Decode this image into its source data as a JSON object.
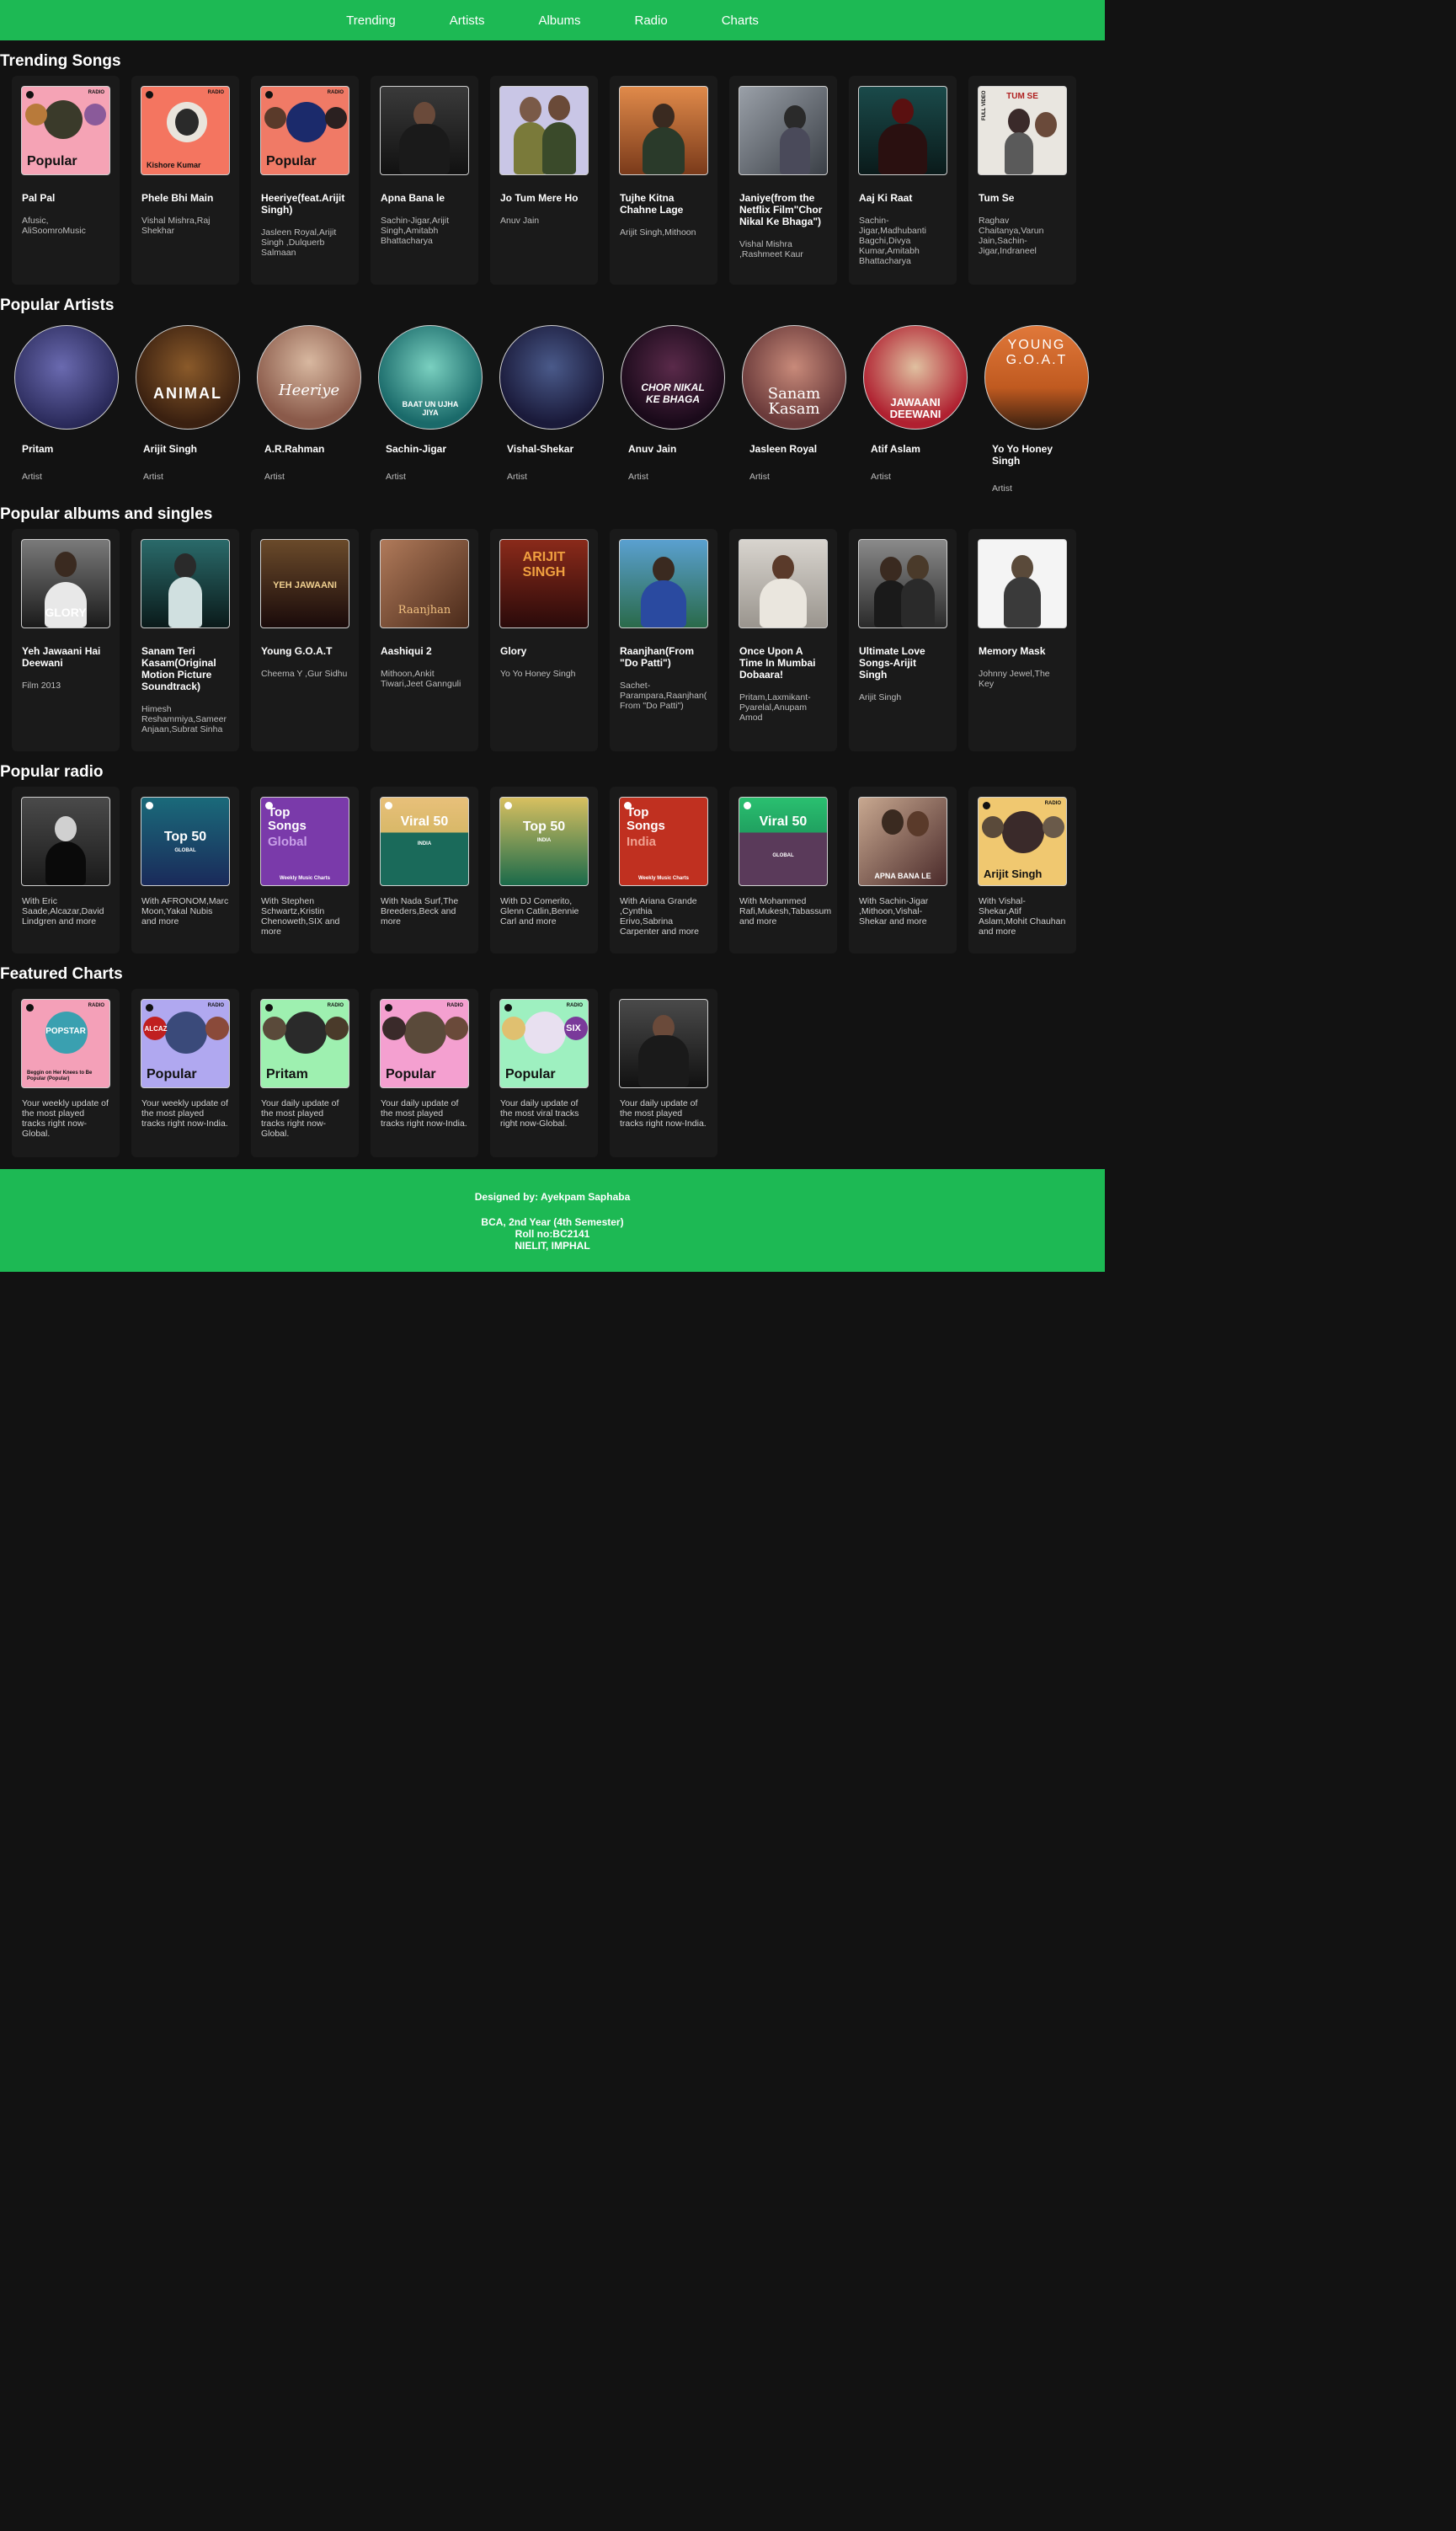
{
  "nav": {
    "items": [
      "Trending",
      "Artists",
      "Albums",
      "Radio",
      "Charts"
    ]
  },
  "sections": {
    "trending": "Trending Songs",
    "artists": "Popular Artists",
    "albums": "Popular albums and singles",
    "radio": "Popular radio",
    "charts": "Featured Charts"
  },
  "trending_songs": [
    {
      "title": "Pal Pal",
      "sub": "Afusic, AliSoomroMusic"
    },
    {
      "title": "Phele Bhi Main",
      "sub": "Vishal Mishra,Raj Shekhar"
    },
    {
      "title": "Heeriye(feat.Arijit Singh)",
      "sub": "Jasleen Royal,Arijit Singh ,Dulquerb Salmaan"
    },
    {
      "title": "Apna Bana le",
      "sub": "Sachin-Jigar,Arijit Singh,Amitabh Bhattacharya"
    },
    {
      "title": "Jo Tum Mere Ho",
      "sub": "Anuv Jain"
    },
    {
      "title": "Tujhe Kitna Chahne Lage",
      "sub": "Arijit Singh,Mithoon"
    },
    {
      "title": "Janiye(from the Netflix Film\"Chor Nikal Ke Bhaga\")",
      "sub": "Vishal Mishra ,Rashmeet Kaur"
    },
    {
      "title": "Aaj Ki Raat",
      "sub": "Sachin-Jigar,Madhubanti Bagchi,Divya Kumar,Amitabh Bhattacharya"
    },
    {
      "title": "Tum Se",
      "sub": "Raghav Chaitanya,Varun Jain,Sachin-Jigar,Indraneel"
    }
  ],
  "trending_covers": [
    {
      "label": "Popular",
      "radio": "RADIO"
    },
    {
      "label": "Kishore Kumar",
      "radio": "RADIO"
    },
    {
      "label": "Popular",
      "radio": "RADIO"
    },
    {},
    {},
    {},
    {},
    {},
    {
      "label": "TUM SE",
      "radio": "FULL VIDEO"
    }
  ],
  "artists": [
    {
      "name": "Pritam",
      "role": "Artist",
      "art": ""
    },
    {
      "name": "Arijit Singh",
      "role": "Artist",
      "art": "ANIMAL"
    },
    {
      "name": "A.R.Rahman",
      "role": "Artist",
      "art": "Heeriye"
    },
    {
      "name": "Sachin-Jigar",
      "role": "Artist",
      "art": "BAAT UN UJHA JIYA"
    },
    {
      "name": "Vishal-Shekar",
      "role": "Artist",
      "art": ""
    },
    {
      "name": "Anuv Jain",
      "role": "Artist",
      "art": "CHOR NIKAL KE BHAGA"
    },
    {
      "name": "Jasleen Royal",
      "role": "Artist",
      "art": "Sanam Kasam"
    },
    {
      "name": "Atif Aslam",
      "role": "Artist",
      "art": "JAWAANI DEEWANI"
    },
    {
      "name": "Yo Yo Honey Singh",
      "role": "Artist",
      "art": "YOUNG G.O.A.T"
    }
  ],
  "albums": [
    {
      "title": "Yeh Jawaani Hai Deewani",
      "sub": "Film 2013",
      "art": "GLORY"
    },
    {
      "title": "Sanam Teri Kasam(Original Motion Picture Soundtrack)",
      "sub": "Himesh Reshammiya,Sameer Anjaan,Subrat Sinha",
      "art": ""
    },
    {
      "title": "Young G.O.A.T",
      "sub": "Cheema Y ,Gur Sidhu",
      "art": "YEH JAWAANI"
    },
    {
      "title": "Aashiqui 2",
      "sub": "Mithoon,Ankit Tiwari,Jeet Gannguli",
      "art": "Raanjhan"
    },
    {
      "title": "Glory",
      "sub": "Yo Yo Honey Singh",
      "art": "ARIJIT SINGH"
    },
    {
      "title": "Raanjhan(From \"Do Patti\")",
      "sub": "Sachet-Parampara,Raanjhan( From \"Do Patti\")",
      "art": ""
    },
    {
      "title": "Once Upon A Time In Mumbai Dobaara!",
      "sub": "Pritam,Laxmikant-Pyarelal,Anupam Amod",
      "art": ""
    },
    {
      "title": "Ultimate Love Songs-Arijit Singh",
      "sub": "Arijit Singh",
      "art": ""
    },
    {
      "title": "Memory Mask",
      "sub": "Johnny Jewel,The Key",
      "art": ""
    }
  ],
  "radio": [
    {
      "desc": "With Eric Saade,Alcazar,David Lindgren and more",
      "big": "",
      "small": ""
    },
    {
      "desc": "With AFRONOM,Marc Moon,Yakal Nubis and more",
      "big": "Top 50",
      "small": "GLOBAL"
    },
    {
      "desc": "With Stephen Schwartz,Kristin Chenoweth,SIX and more",
      "big": "Top Songs",
      "small": "Global",
      "foot": "Weekly Music Charts"
    },
    {
      "desc": "With Nada Surf,The Breeders,Beck and more",
      "big": "Viral 50",
      "small": "INDIA"
    },
    {
      "desc": "With DJ Comerito, Glenn Catlin,Bennie Carl and more",
      "big": "Top 50",
      "small": "INDIA"
    },
    {
      "desc": "With Ariana Grande ,Cynthia Erivo,Sabrina Carpenter and more",
      "big": "Top Songs",
      "small": "India",
      "foot": "Weekly Music Charts"
    },
    {
      "desc": "With Mohammed Rafi,Mukesh,Tabassum and more",
      "big": "Viral 50",
      "small": "GLOBAL"
    },
    {
      "desc": "With Sachin-Jigar ,Mithoon,Vishal-Shekar and more",
      "big": "APNA BANA LE",
      "small": ""
    },
    {
      "desc": "With Vishal-Shekar,Atif Aslam,Mohit Chauhan and more",
      "big": "Arijit Singh",
      "small": "RADIO"
    }
  ],
  "charts": [
    {
      "desc": "Your weekly update of the most played tracks right now-Global.",
      "label": "Beggin on Her Knees to Be Popular (Popular)",
      "art": "POPSTAR"
    },
    {
      "desc": "Your weekly update of the most played tracks right now-India.",
      "label": "Popular",
      "art": "ALCAZ"
    },
    {
      "desc": "Your daily update of the most played tracks right now-Global.",
      "label": "Pritam",
      "art": ""
    },
    {
      "desc": "Your daily update of the most played tracks right now-India.",
      "label": "Popular",
      "art": ""
    },
    {
      "desc": "Your daily update of the most viral tracks right now-Global.",
      "label": "Popular",
      "art": "SIX"
    },
    {
      "desc": "Your daily update of the most played tracks right now-India.",
      "label": "",
      "art": ""
    }
  ],
  "footer": {
    "designer": "Designed by: Ayekpam Saphaba",
    "line1": "BCA, 2nd Year (4th Semester)",
    "line2": "Roll no:BC2141",
    "line3": "NIELIT, IMPHAL"
  },
  "colors": {
    "accent": "#1db954",
    "background": "#121212",
    "card": "#1a1a1a"
  }
}
